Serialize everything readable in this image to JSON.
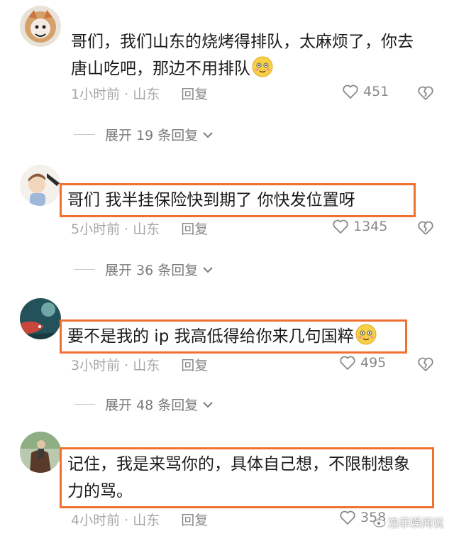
{
  "comments": [
    {
      "username": "",
      "text": "哥们，我们山东的烧烤得排队，太麻烦了，你去唐山吃吧，那边不用排队",
      "has_emoji": true,
      "time_location": "1小时前 · 山东",
      "reply_label": "回复",
      "likes": "451",
      "expand_label": "展开 19 条回复",
      "highlighted": false
    },
    {
      "username": "",
      "text": "哥们  我半挂保险快到期了 你快发位置呀",
      "has_emoji": false,
      "time_location": "5小时前 · 山东",
      "reply_label": "回复",
      "likes": "1345",
      "expand_label": "展开 36 条回复",
      "highlighted": true
    },
    {
      "username": "",
      "text": "要不是我的 ip 我高低得给你来几句国粹",
      "has_emoji": true,
      "time_location": "3小时前 · 山东",
      "reply_label": "回复",
      "likes": "495",
      "expand_label": "展开 48 条回复",
      "highlighted": true
    },
    {
      "username": "",
      "text": "记住，我是来骂你的，具体自己想，不限制想象力的骂。",
      "has_emoji": false,
      "time_location": "4小时前 · 山东",
      "reply_label": "回复",
      "likes": "358",
      "highlighted": true
    }
  ],
  "watermark": "浩菲娱闻说",
  "colors": {
    "highlight": "#f07030",
    "meta": "#a7a7a7"
  }
}
